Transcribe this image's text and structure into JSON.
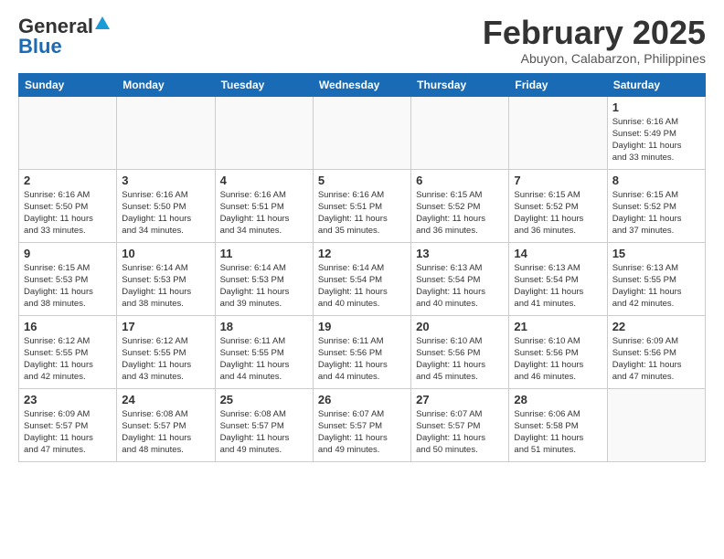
{
  "header": {
    "logo_general": "General",
    "logo_blue": "Blue",
    "month": "February 2025",
    "location": "Abuyon, Calabarzon, Philippines"
  },
  "weekdays": [
    "Sunday",
    "Monday",
    "Tuesday",
    "Wednesday",
    "Thursday",
    "Friday",
    "Saturday"
  ],
  "weeks": [
    [
      {
        "day": "",
        "info": ""
      },
      {
        "day": "",
        "info": ""
      },
      {
        "day": "",
        "info": ""
      },
      {
        "day": "",
        "info": ""
      },
      {
        "day": "",
        "info": ""
      },
      {
        "day": "",
        "info": ""
      },
      {
        "day": "1",
        "info": "Sunrise: 6:16 AM\nSunset: 5:49 PM\nDaylight: 11 hours\nand 33 minutes."
      }
    ],
    [
      {
        "day": "2",
        "info": "Sunrise: 6:16 AM\nSunset: 5:50 PM\nDaylight: 11 hours\nand 33 minutes."
      },
      {
        "day": "3",
        "info": "Sunrise: 6:16 AM\nSunset: 5:50 PM\nDaylight: 11 hours\nand 34 minutes."
      },
      {
        "day": "4",
        "info": "Sunrise: 6:16 AM\nSunset: 5:51 PM\nDaylight: 11 hours\nand 34 minutes."
      },
      {
        "day": "5",
        "info": "Sunrise: 6:16 AM\nSunset: 5:51 PM\nDaylight: 11 hours\nand 35 minutes."
      },
      {
        "day": "6",
        "info": "Sunrise: 6:15 AM\nSunset: 5:52 PM\nDaylight: 11 hours\nand 36 minutes."
      },
      {
        "day": "7",
        "info": "Sunrise: 6:15 AM\nSunset: 5:52 PM\nDaylight: 11 hours\nand 36 minutes."
      },
      {
        "day": "8",
        "info": "Sunrise: 6:15 AM\nSunset: 5:52 PM\nDaylight: 11 hours\nand 37 minutes."
      }
    ],
    [
      {
        "day": "9",
        "info": "Sunrise: 6:15 AM\nSunset: 5:53 PM\nDaylight: 11 hours\nand 38 minutes."
      },
      {
        "day": "10",
        "info": "Sunrise: 6:14 AM\nSunset: 5:53 PM\nDaylight: 11 hours\nand 38 minutes."
      },
      {
        "day": "11",
        "info": "Sunrise: 6:14 AM\nSunset: 5:53 PM\nDaylight: 11 hours\nand 39 minutes."
      },
      {
        "day": "12",
        "info": "Sunrise: 6:14 AM\nSunset: 5:54 PM\nDaylight: 11 hours\nand 40 minutes."
      },
      {
        "day": "13",
        "info": "Sunrise: 6:13 AM\nSunset: 5:54 PM\nDaylight: 11 hours\nand 40 minutes."
      },
      {
        "day": "14",
        "info": "Sunrise: 6:13 AM\nSunset: 5:54 PM\nDaylight: 11 hours\nand 41 minutes."
      },
      {
        "day": "15",
        "info": "Sunrise: 6:13 AM\nSunset: 5:55 PM\nDaylight: 11 hours\nand 42 minutes."
      }
    ],
    [
      {
        "day": "16",
        "info": "Sunrise: 6:12 AM\nSunset: 5:55 PM\nDaylight: 11 hours\nand 42 minutes."
      },
      {
        "day": "17",
        "info": "Sunrise: 6:12 AM\nSunset: 5:55 PM\nDaylight: 11 hours\nand 43 minutes."
      },
      {
        "day": "18",
        "info": "Sunrise: 6:11 AM\nSunset: 5:55 PM\nDaylight: 11 hours\nand 44 minutes."
      },
      {
        "day": "19",
        "info": "Sunrise: 6:11 AM\nSunset: 5:56 PM\nDaylight: 11 hours\nand 44 minutes."
      },
      {
        "day": "20",
        "info": "Sunrise: 6:10 AM\nSunset: 5:56 PM\nDaylight: 11 hours\nand 45 minutes."
      },
      {
        "day": "21",
        "info": "Sunrise: 6:10 AM\nSunset: 5:56 PM\nDaylight: 11 hours\nand 46 minutes."
      },
      {
        "day": "22",
        "info": "Sunrise: 6:09 AM\nSunset: 5:56 PM\nDaylight: 11 hours\nand 47 minutes."
      }
    ],
    [
      {
        "day": "23",
        "info": "Sunrise: 6:09 AM\nSunset: 5:57 PM\nDaylight: 11 hours\nand 47 minutes."
      },
      {
        "day": "24",
        "info": "Sunrise: 6:08 AM\nSunset: 5:57 PM\nDaylight: 11 hours\nand 48 minutes."
      },
      {
        "day": "25",
        "info": "Sunrise: 6:08 AM\nSunset: 5:57 PM\nDaylight: 11 hours\nand 49 minutes."
      },
      {
        "day": "26",
        "info": "Sunrise: 6:07 AM\nSunset: 5:57 PM\nDaylight: 11 hours\nand 49 minutes."
      },
      {
        "day": "27",
        "info": "Sunrise: 6:07 AM\nSunset: 5:57 PM\nDaylight: 11 hours\nand 50 minutes."
      },
      {
        "day": "28",
        "info": "Sunrise: 6:06 AM\nSunset: 5:58 PM\nDaylight: 11 hours\nand 51 minutes."
      },
      {
        "day": "",
        "info": ""
      }
    ]
  ]
}
